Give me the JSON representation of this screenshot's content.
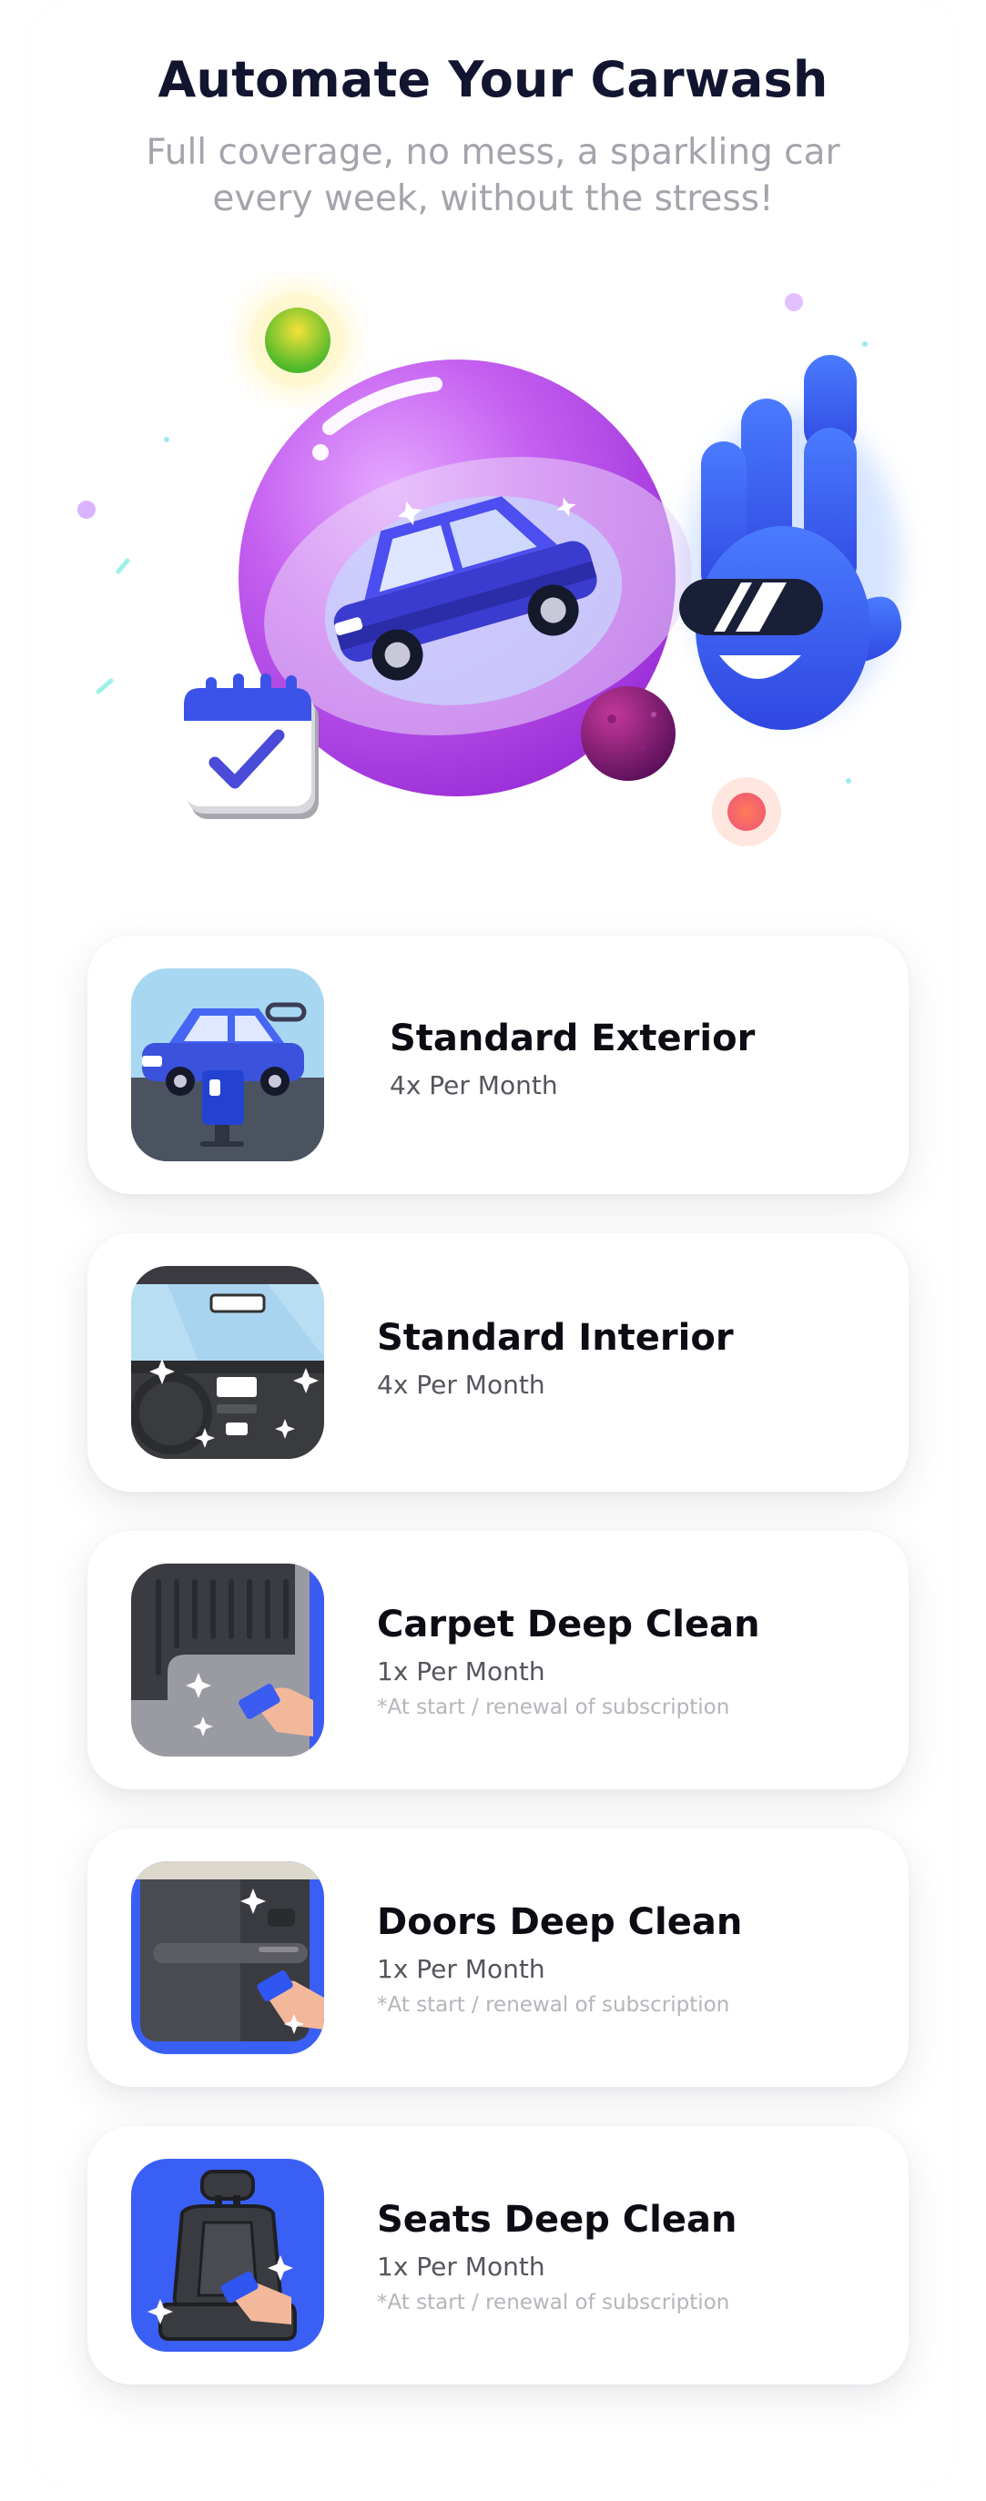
{
  "header": {
    "title": "Automate Your Carwash",
    "subtitle": "Full coverage, no mess, a sparkling car every week, without the stress!"
  },
  "colors": {
    "title": "#121530",
    "subtitle": "#a4a4ac",
    "accent_blue": "#3b5bf0",
    "accent_purple": "#b348e0"
  },
  "hero": {
    "icons": [
      "sphere-icon",
      "car-icon",
      "calendar-icon",
      "mascot-icon",
      "planet-icon",
      "orb-icon"
    ]
  },
  "services": [
    {
      "name": "Standard Exterior",
      "frequency": "4x Per Month",
      "note": "",
      "icon": "car-exterior-icon"
    },
    {
      "name": "Standard Interior",
      "frequency": "4x Per Month",
      "note": "",
      "icon": "car-interior-icon"
    },
    {
      "name": "Carpet Deep Clean",
      "frequency": "1x Per Month",
      "note": "*At start / renewal of subscription",
      "icon": "carpet-icon"
    },
    {
      "name": "Doors Deep Clean",
      "frequency": "1x Per Month",
      "note": "*At start / renewal of subscription",
      "icon": "door-icon"
    },
    {
      "name": "Seats Deep Clean",
      "frequency": "1x Per Month",
      "note": "*At start / renewal of subscription",
      "icon": "seat-icon"
    }
  ]
}
